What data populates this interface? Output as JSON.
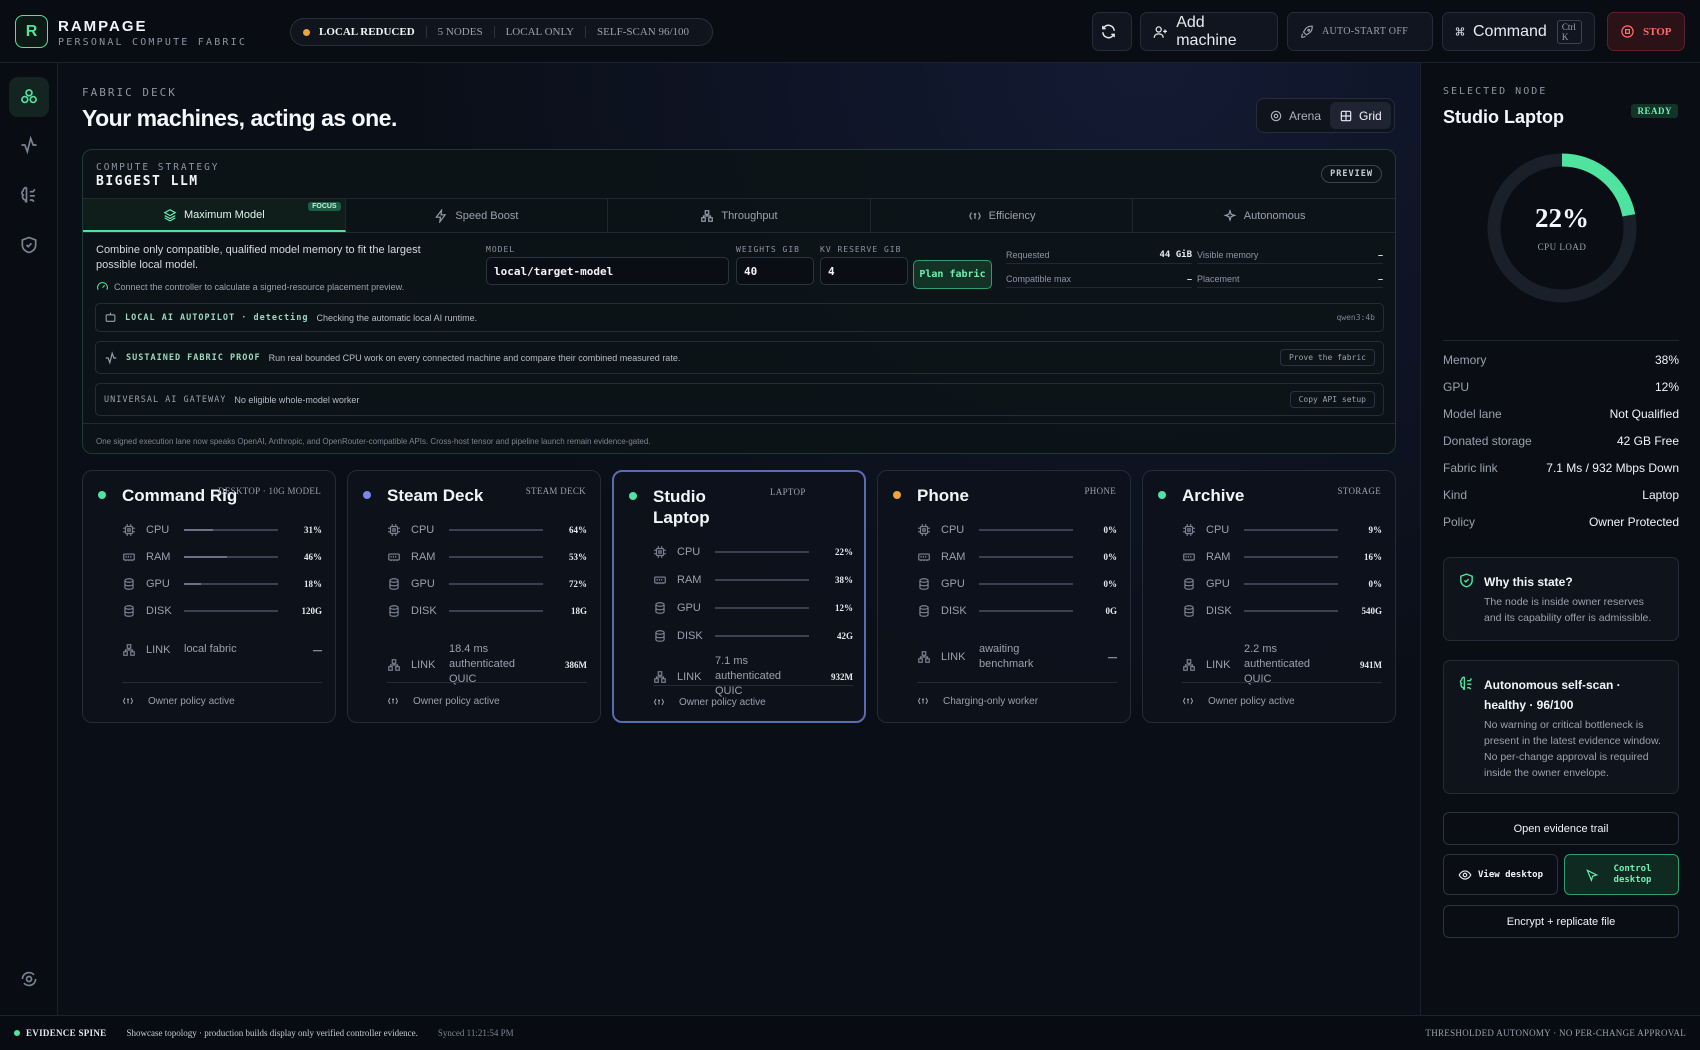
{
  "brand": {
    "logo": "R",
    "name": "RAMPAGE",
    "subtitle": "PERSONAL COMPUTE FABRIC"
  },
  "status_pill": {
    "mode": "LOCAL REDUCED",
    "nodes": "5 NODES",
    "scope": "LOCAL ONLY",
    "self_scan": "SELF-SCAN 96/100",
    "dot_color": "#f0a23a"
  },
  "toolbar": {
    "add_machine": "Add machine",
    "auto_start": "AUTO-START OFF",
    "command": "Command",
    "command_shortcut": "Ctrl K",
    "stop": "STOP"
  },
  "main": {
    "eyebrow": "FABRIC DECK",
    "title": "Your machines, acting as one.",
    "view_arena": "Arena",
    "view_grid": "Grid",
    "view_selected": "Grid"
  },
  "strategy": {
    "eyebrow": "COMPUTE STRATEGY",
    "name": "BIGGEST LLM",
    "preview": "PREVIEW",
    "tabs": [
      {
        "label": "Maximum Model",
        "badge": "FOCUS",
        "active": true
      },
      {
        "label": "Speed Boost"
      },
      {
        "label": "Throughput"
      },
      {
        "label": "Efficiency"
      },
      {
        "label": "Autonomous"
      }
    ],
    "description": "Combine only compatible, qualified model memory to fit the largest possible local model.",
    "hint": "Connect the controller to calculate a signed-resource placement preview.",
    "model_label": "MODEL",
    "model_value": "local/target-model",
    "weights_label": "WEIGHTS GIB",
    "weights_value": "40",
    "kv_label": "KV RESERVE GIB",
    "kv_value": "4",
    "plan_button": "Plan fabric",
    "requested_label": "Requested",
    "requested_value": "44 GiB",
    "visible_label": "Visible memory",
    "visible_value": "–",
    "compatible_label": "Compatible max",
    "compatible_value": "–",
    "placement_label": "Placement",
    "placement_value": "–",
    "autopilot": {
      "label": "LOCAL AI AUTOPILOT · detecting",
      "text": "Checking the automatic local AI runtime.",
      "tag": "qwen3:4b"
    },
    "proof": {
      "label": "SUSTAINED FABRIC PROOF",
      "text": "Run real bounded CPU work on every connected machine and compare their combined measured rate.",
      "button": "Prove the fabric"
    },
    "gateway": {
      "label": "UNIVERSAL AI GATEWAY",
      "text": "No eligible whole-model worker",
      "button": "Copy API setup"
    },
    "footnote": "One signed execution lane now speaks OpenAI, Anthropic, and OpenRouter-compatible APIs. Cross-host tensor and pipeline launch remain evidence-gated."
  },
  "nodes": [
    {
      "name": "Command Rig",
      "kind": "DESKTOP · 10G MODEL",
      "dot": "#4fe3a0",
      "cpu": "31%",
      "ram": "46%",
      "gpu": "18%",
      "disk": "120G",
      "cpu_f": 0.31,
      "ram_f": 0.46,
      "gpu_f": 0.18,
      "disk_f": 0,
      "link_label": "LINK",
      "link": "local fabric",
      "link_v": "—",
      "footer": "Owner policy active",
      "selected": false
    },
    {
      "name": "Steam Deck",
      "kind": "STEAM DECK",
      "dot": "#7b86e8",
      "cpu": "64%",
      "ram": "53%",
      "gpu": "72%",
      "disk": "18G",
      "cpu_f": 0,
      "ram_f": 0,
      "gpu_f": 0,
      "disk_f": 0,
      "link_label": "LINK",
      "link": "18.4 ms authenticated QUIC",
      "link_v": "386M",
      "footer": "Owner policy active",
      "selected": false
    },
    {
      "name": "Studio Laptop",
      "kind": "LAPTOP",
      "dot": "#4fe3a0",
      "cpu": "22%",
      "ram": "38%",
      "gpu": "12%",
      "disk": "42G",
      "cpu_f": 0,
      "ram_f": 0,
      "gpu_f": 0,
      "disk_f": 0,
      "link_label": "LINK",
      "link": "7.1 ms authenticated QUIC",
      "link_v": "932M",
      "footer": "Owner policy active",
      "selected": true
    },
    {
      "name": "Phone",
      "kind": "PHONE",
      "dot": "#f0a23a",
      "cpu": "0%",
      "ram": "0%",
      "gpu": "0%",
      "disk": "0G",
      "cpu_f": 0,
      "ram_f": 0,
      "gpu_f": 0,
      "disk_f": 0,
      "link_label": "LINK",
      "link": "awaiting benchmark",
      "link_v": "—",
      "footer": "Charging-only worker",
      "selected": false
    },
    {
      "name": "Archive",
      "kind": "STORAGE",
      "dot": "#4fe3a0",
      "cpu": "9%",
      "ram": "16%",
      "gpu": "0%",
      "disk": "540G",
      "cpu_f": 0,
      "ram_f": 0,
      "gpu_f": 0,
      "disk_f": 0,
      "link_label": "LINK",
      "link": "2.2 ms authenticated QUIC",
      "link_v": "941M",
      "footer": "Owner policy active",
      "selected": false
    }
  ],
  "metric_labels": {
    "cpu": "CPU",
    "ram": "RAM",
    "gpu": "GPU",
    "disk": "DISK"
  },
  "side": {
    "eyebrow": "SELECTED NODE",
    "name": "Studio Laptop",
    "status": "READY",
    "gauge_value": "22%",
    "gauge_fraction": 0.22,
    "gauge_label": "CPU LOAD",
    "accent": "#4fe3a0",
    "stats": [
      {
        "k": "Memory",
        "v": "38%"
      },
      {
        "k": "GPU",
        "v": "12%"
      },
      {
        "k": "Model lane",
        "v": "Not Qualified"
      },
      {
        "k": "Donated storage",
        "v": "42 GB Free"
      },
      {
        "k": "Fabric link",
        "v": "7.1 Ms / 932 Mbps Down"
      },
      {
        "k": "Kind",
        "v": "Laptop"
      },
      {
        "k": "Policy",
        "v": "Owner Protected"
      }
    ],
    "why_title": "Why this state?",
    "why_text": "The node is inside owner reserves and its capability offer is admissible.",
    "auto_title": "Autonomous self-scan · healthy · 96/100",
    "auto_text": "No warning or critical bottleneck is present in the latest evidence window. No per-change approval is required inside the owner envelope.",
    "evidence_button": "Open evidence trail",
    "view_desktop": "View desktop",
    "control_desktop": "Control desktop",
    "encrypt_button": "Encrypt + replicate file"
  },
  "footer": {
    "spine": "EVIDENCE SPINE",
    "note": "Showcase topology · production builds display only verified controller evidence.",
    "synced": "Synced 11:21:54 PM",
    "right": "THRESHOLDED AUTONOMY · NO PER-CHANGE APPROVAL"
  }
}
